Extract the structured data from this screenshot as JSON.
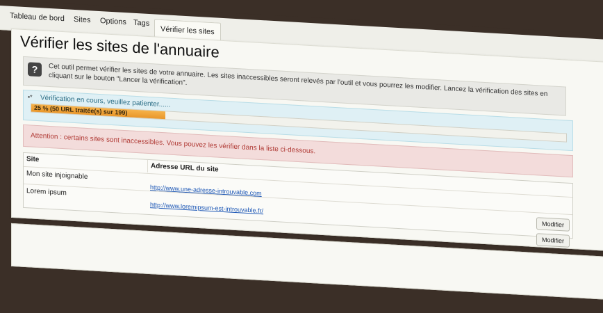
{
  "tabs": [
    {
      "label": "Tableau de bord"
    },
    {
      "label": "Sites"
    },
    {
      "label": "Options"
    },
    {
      "label": "Tags"
    },
    {
      "label": "Vérifier les sites"
    }
  ],
  "page_title": "Vérifier les sites de l'annuaire",
  "info_text": "Cet outil permet vérifier les sites de votre annuaire. Les sites inaccessibles seront relevés par l'outil et vous pourrez les modifier. Lancez la vérification des sites en cliquant sur le bouton \"Lancer la vérification\".",
  "progress": {
    "message": "Vérification en cours, veuillez patienter......",
    "label": "25 % (50 URL traitée(s) sur 199)",
    "fraction": 0.25
  },
  "alert_text": "Attention : certains sites sont inaccessibles. Vous pouvez les vérifier dans la liste ci-dessous.",
  "table": {
    "headers": [
      "Site",
      "Adresse URL du site"
    ],
    "rows": [
      {
        "site": "Mon site injoignable",
        "url": "http://www.une-adresse-introuvable.com",
        "button": "Modifier"
      },
      {
        "site": "Lorem ipsum",
        "url": "http://www.loremipsum-est-introuvable.fr/",
        "button": "Modifier"
      }
    ]
  },
  "colors": {
    "progress_fill": "#f0a43a",
    "alert_text": "#b03a35",
    "link": "#1a55b5"
  }
}
